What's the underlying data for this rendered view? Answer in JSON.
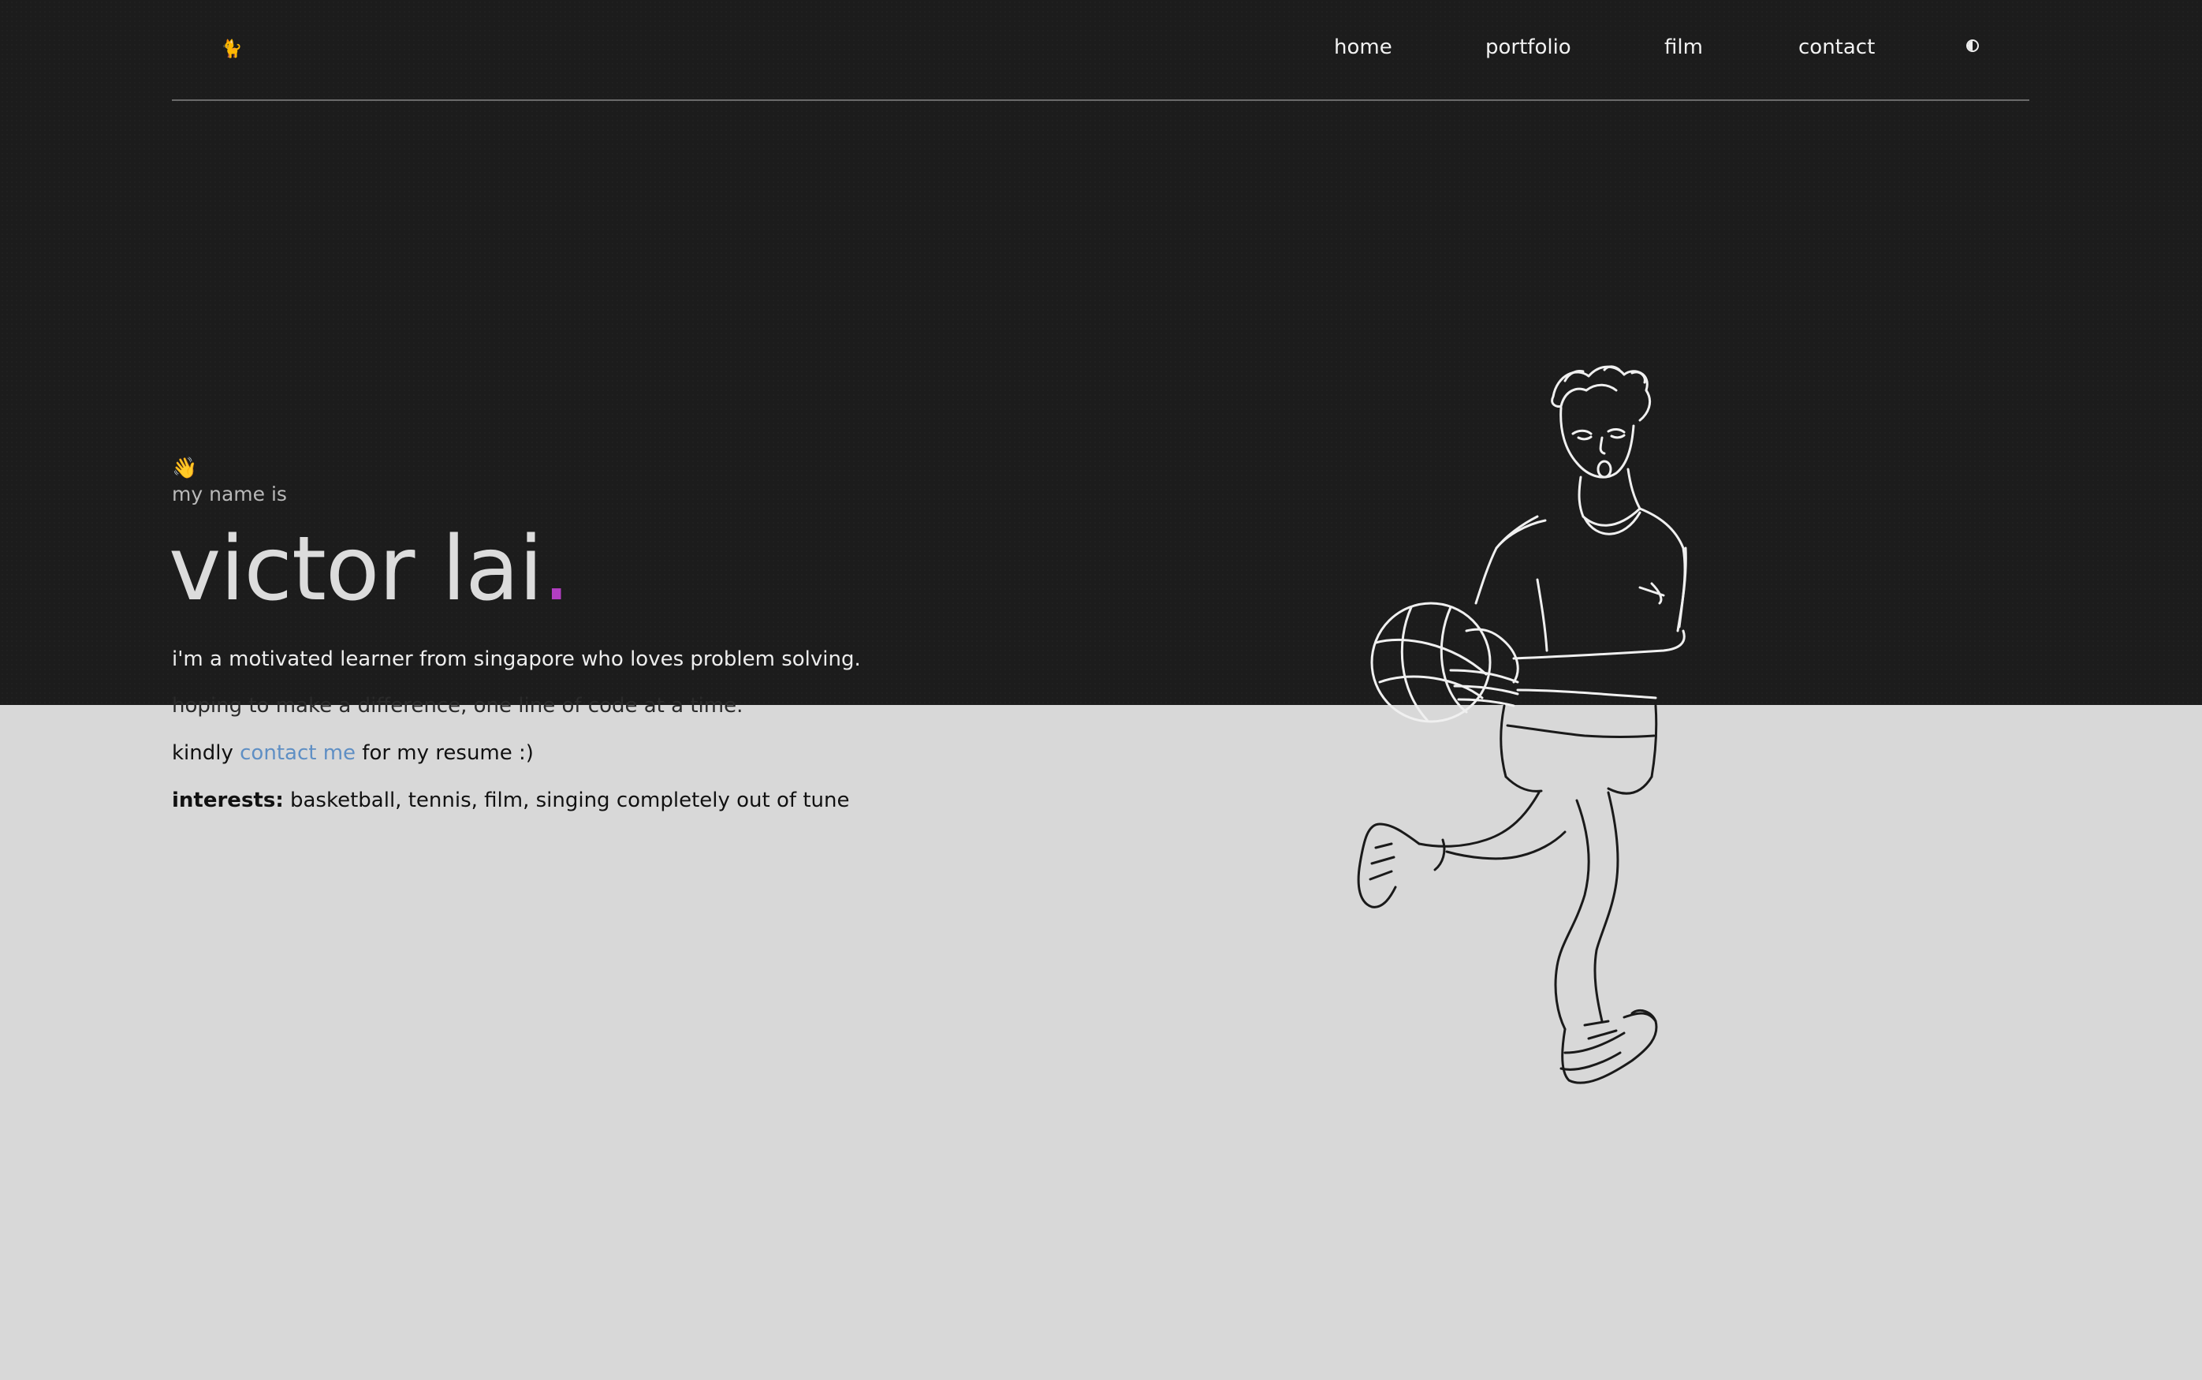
{
  "header": {
    "logo_glyph": "🐈",
    "nav": [
      "home",
      "portfolio",
      "film",
      "contact"
    ],
    "theme_toggle_icon": "half-circle-icon"
  },
  "hero": {
    "wave_emoji": "👋",
    "intro": "my name is",
    "name": "victor lai",
    "name_dot": ".",
    "bio_line_1": "i'm a motivated learner from singapore who loves problem solving.",
    "bio_line_2": "hoping to make a difference, one line of code at a time.",
    "resume_prefix": "kindly",
    "resume_link": "contact me",
    "resume_suffix": "for my resume :)",
    "interests_label": "interests:",
    "interests_value": "basketball, tennis, film, singing completely out of tune"
  },
  "colors": {
    "dark_bg": "#1c1c1c",
    "light_bg": "#d8d8d8",
    "accent_dot": "#b23ec2",
    "link": "#5f8fc4"
  },
  "illustration": {
    "icon": "basketball-player-line-drawing"
  }
}
